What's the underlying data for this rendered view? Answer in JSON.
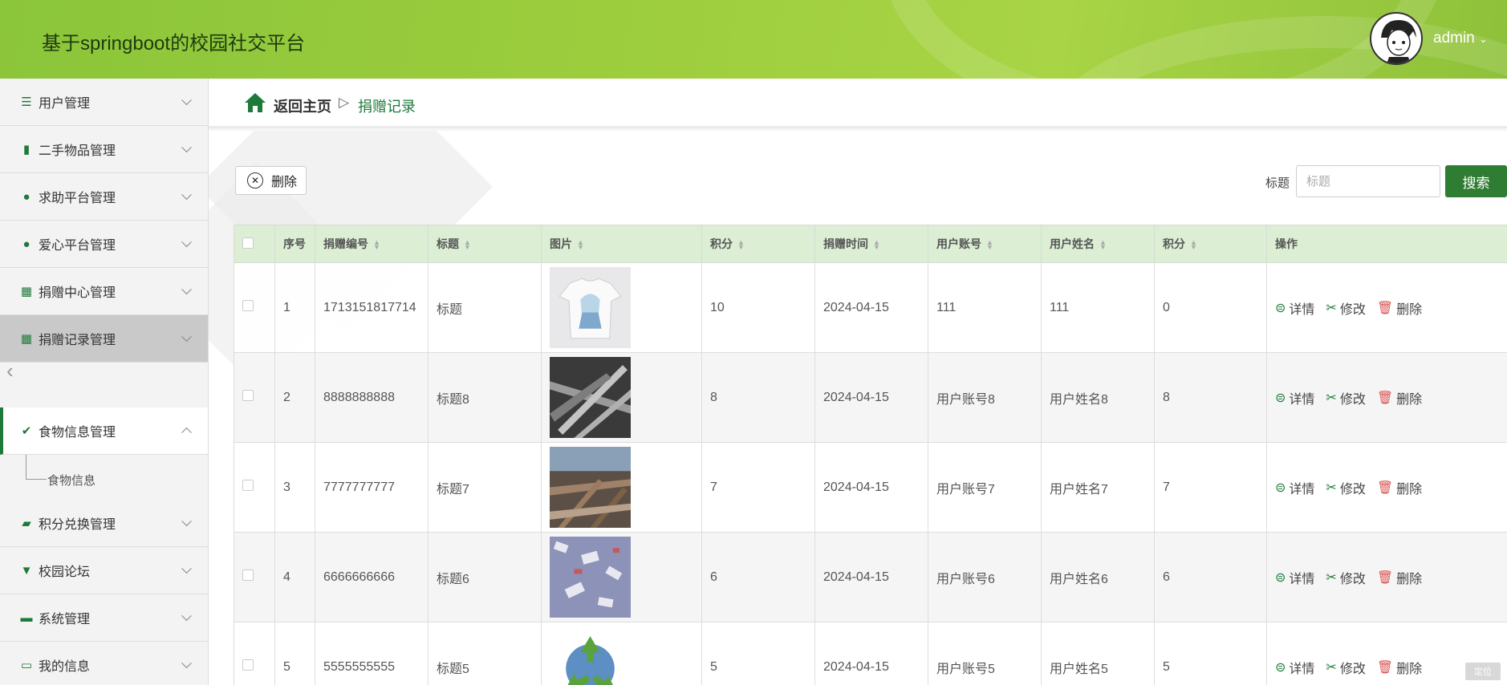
{
  "header": {
    "title": "基于springboot的校园社交平台",
    "user": "admin"
  },
  "sidebar": {
    "items": [
      {
        "label": "用户管理",
        "icon": "sliders-icon"
      },
      {
        "label": "二手物品管理",
        "icon": "books-icon"
      },
      {
        "label": "求助平台管理",
        "icon": "person-icon"
      },
      {
        "label": "爱心平台管理",
        "icon": "person-icon"
      },
      {
        "label": "捐赠中心管理",
        "icon": "grid-icon"
      },
      {
        "label": "捐赠记录管理",
        "icon": "grid-icon"
      },
      {
        "label": "食物信息管理",
        "icon": "clipboard-icon"
      },
      {
        "label": "积分兑换管理",
        "icon": "briefcase-icon"
      },
      {
        "label": "校园论坛",
        "icon": "pin-icon"
      },
      {
        "label": "系统管理",
        "icon": "monitor-icon"
      },
      {
        "label": "我的信息",
        "icon": "card-icon"
      }
    ],
    "submenu_label": "食物信息"
  },
  "breadcrumb": {
    "home": "返回主页",
    "sep": "▷",
    "current": "捐赠记录"
  },
  "toolbar": {
    "delete_label": "删除",
    "search_label": "标题",
    "search_placeholder": "标题",
    "search_button": "搜索"
  },
  "table": {
    "columns": [
      "序号",
      "捐赠编号",
      "标题",
      "图片",
      "积分",
      "捐赠时间",
      "用户账号",
      "用户姓名",
      "积分",
      "操作"
    ],
    "rows": [
      {
        "no": "1",
        "code": "1713151817714",
        "title": "标题",
        "img": "tshirt",
        "points": "10",
        "time": "2024-04-15",
        "account": "111",
        "name": "111",
        "score": "0"
      },
      {
        "no": "2",
        "code": "8888888888",
        "title": "标题8",
        "img": "scrap",
        "points": "8",
        "time": "2024-04-15",
        "account": "用户账号8",
        "name": "用户姓名8",
        "score": "8"
      },
      {
        "no": "3",
        "code": "7777777777",
        "title": "标题7",
        "img": "wood",
        "points": "7",
        "time": "2024-04-15",
        "account": "用户账号7",
        "name": "用户姓名7",
        "score": "7"
      },
      {
        "no": "4",
        "code": "6666666666",
        "title": "标题6",
        "img": "paper",
        "points": "6",
        "time": "2024-04-15",
        "account": "用户账号6",
        "name": "用户姓名6",
        "score": "6"
      },
      {
        "no": "5",
        "code": "5555555555",
        "title": "标题5",
        "img": "recycle",
        "points": "5",
        "time": "2024-04-15",
        "account": "用户账号5",
        "name": "用户姓名5",
        "score": "5"
      }
    ],
    "ops": {
      "detail": "详情",
      "edit": "修改",
      "delete": "删除"
    }
  },
  "corner_badge": "定位"
}
